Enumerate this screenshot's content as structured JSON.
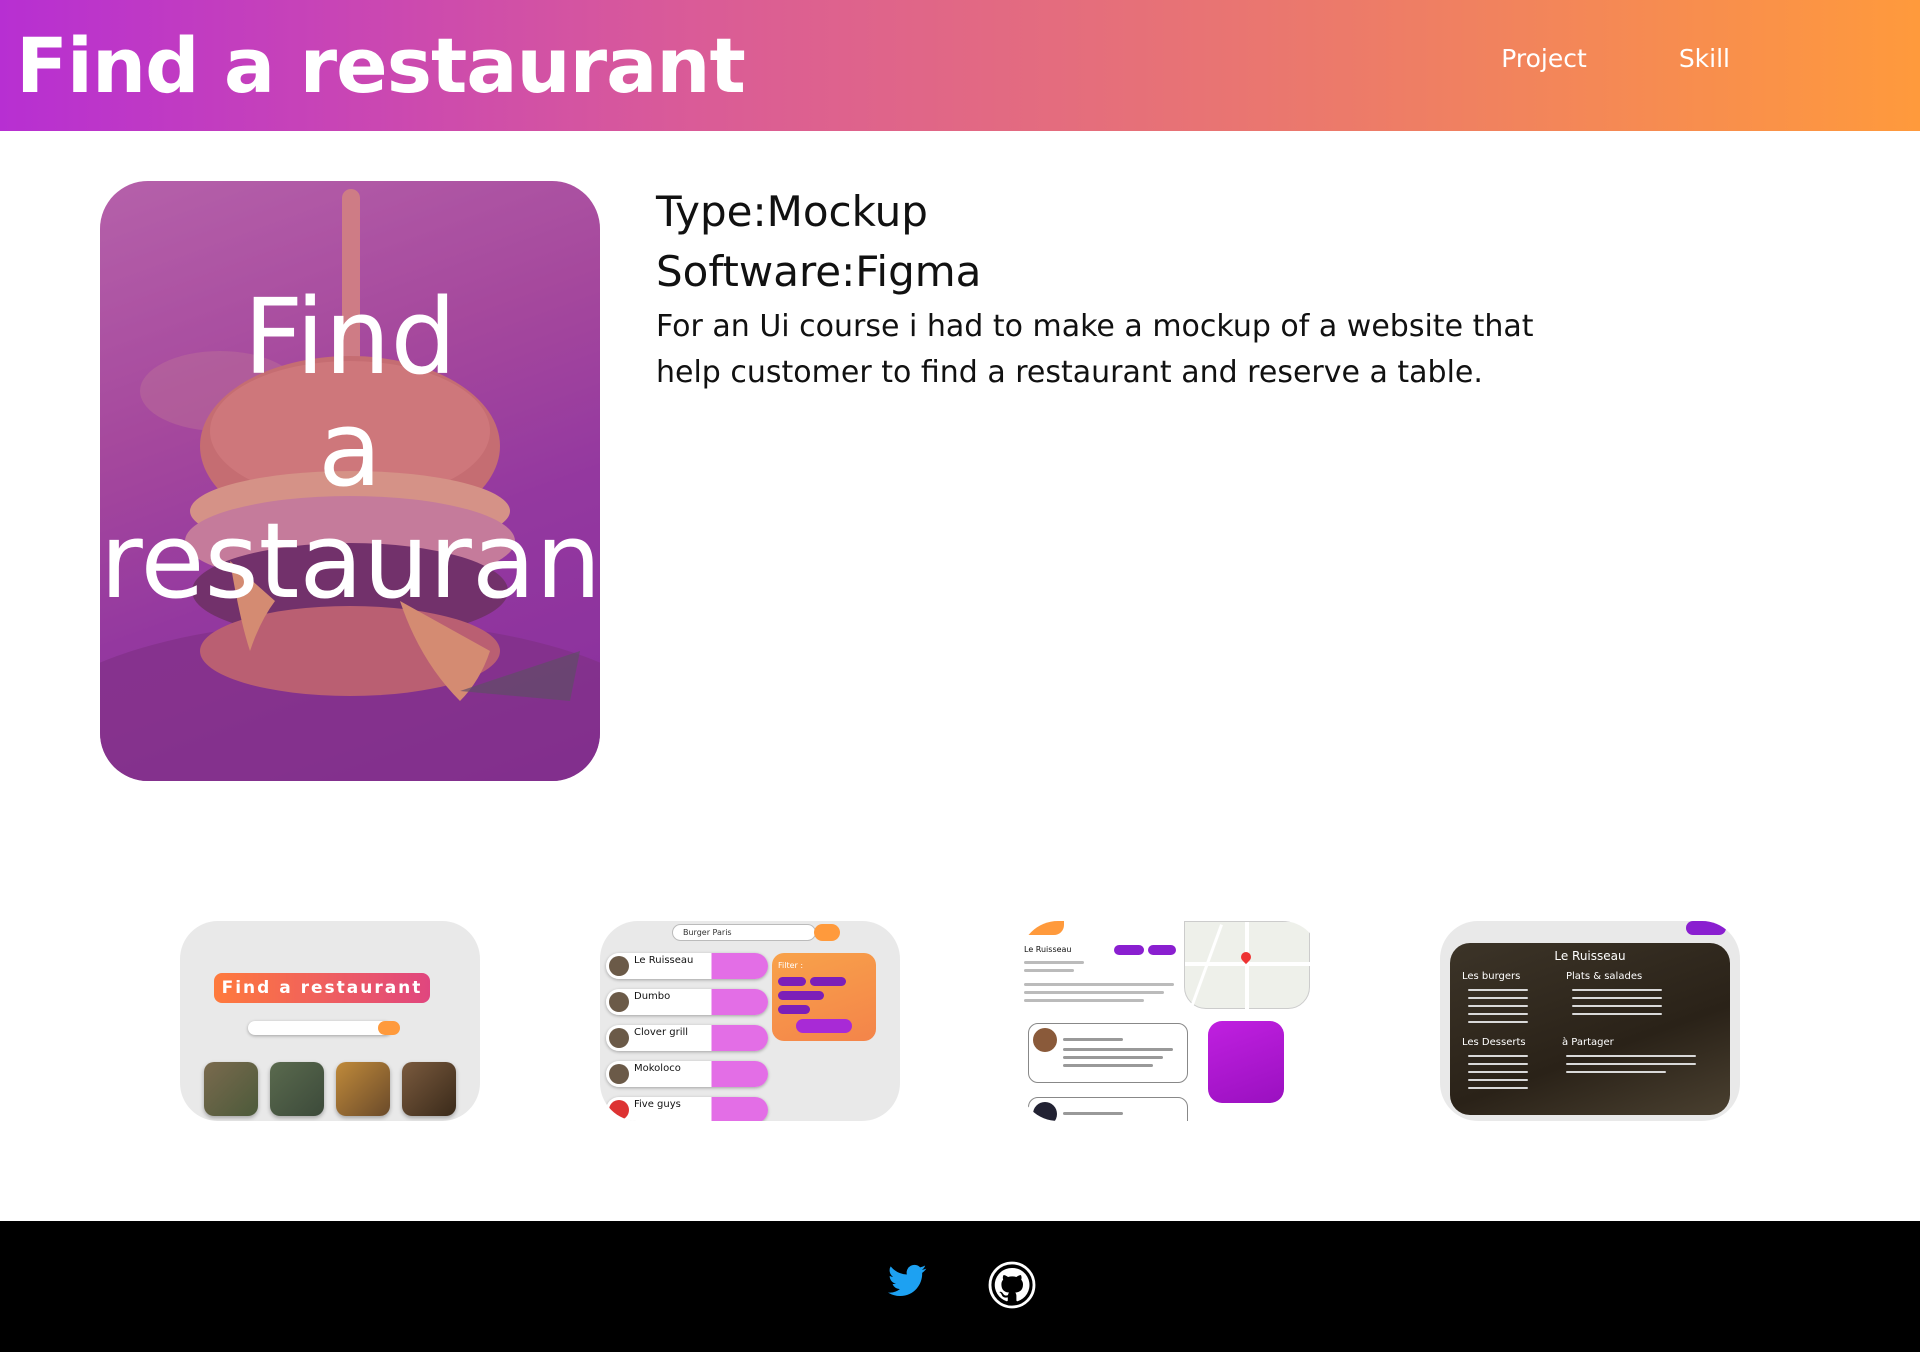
{
  "header": {
    "title": "Find a restaurant",
    "nav": [
      "Project",
      "Skill"
    ]
  },
  "hero": {
    "title_lines": [
      "Find",
      "a",
      "restaurant"
    ]
  },
  "project": {
    "type_label": "Type:Mockup",
    "software_label": "Software:Figma",
    "description": "For an Ui course i had to make a mockup of a website that help customer to find a restaurant and reserve a table."
  },
  "thumbnails": {
    "t1": {
      "banner": "Find a restaurant"
    },
    "t2": {
      "search": "Burger Paris",
      "rows": [
        "Le Ruisseau",
        "Dumbo",
        "Clover grill",
        "Mokoloco",
        "Five guys"
      ],
      "filter": "Filter :"
    },
    "t3": {
      "name": "Le Ruisseau"
    },
    "t4": {
      "title": "Le Ruisseau",
      "sections": [
        "Les burgers",
        "Plats & salades",
        "Les Desserts",
        "à Partager"
      ]
    }
  },
  "footer": {
    "icons": [
      "twitter-icon",
      "github-icon"
    ]
  },
  "colors": {
    "header_gradient_start": "#b72fd2",
    "header_gradient_end": "#ff9a3c",
    "twitter": "#1da1f2",
    "footer_bg": "#000000"
  }
}
